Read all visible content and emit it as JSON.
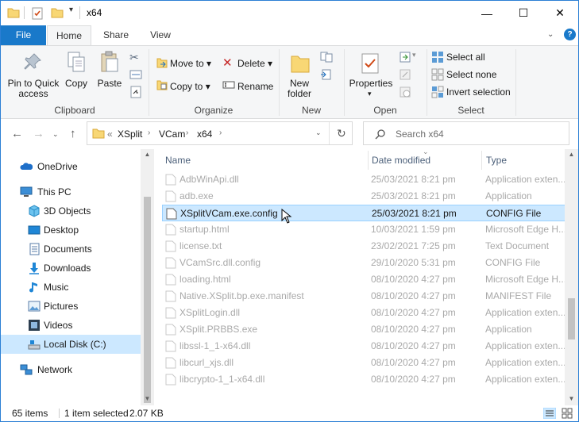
{
  "window": {
    "title": "x64",
    "controls": {
      "minimize": "—",
      "maximize": "☐",
      "close": "✕"
    }
  },
  "ribbon_tabs": [
    "File",
    "Home",
    "Share",
    "View"
  ],
  "ribbon": {
    "clipboard": {
      "label": "Clipboard",
      "pin_to_quick_access": "Pin to Quick\naccess",
      "copy": "Copy",
      "paste": "Paste"
    },
    "organize": {
      "label": "Organize",
      "move_to": "Move to",
      "copy_to": "Copy to",
      "delete": "Delete",
      "rename": "Rename"
    },
    "new": {
      "label": "New",
      "new_folder": "New\nfolder"
    },
    "open": {
      "label": "Open",
      "properties": "Properties"
    },
    "select": {
      "label": "Select",
      "select_all": "Select all",
      "select_none": "Select none",
      "invert_selection": "Invert selection"
    }
  },
  "address": {
    "crumbs": [
      "XSplit",
      "VCam",
      "x64"
    ],
    "overflow": "«"
  },
  "search": {
    "placeholder": "Search x64"
  },
  "nav_pane": {
    "items": [
      {
        "label": "OneDrive",
        "icon": "onedrive-icon"
      },
      {
        "label": "This PC",
        "icon": "computer-icon"
      },
      {
        "label": "3D Objects",
        "icon": "3d-objects-icon"
      },
      {
        "label": "Desktop",
        "icon": "desktop-icon"
      },
      {
        "label": "Documents",
        "icon": "documents-icon"
      },
      {
        "label": "Downloads",
        "icon": "downloads-icon"
      },
      {
        "label": "Music",
        "icon": "music-icon"
      },
      {
        "label": "Pictures",
        "icon": "pictures-icon"
      },
      {
        "label": "Videos",
        "icon": "videos-icon"
      },
      {
        "label": "Local Disk (C:)",
        "icon": "disk-icon"
      },
      {
        "label": "Network",
        "icon": "network-icon"
      }
    ]
  },
  "columns": [
    "Name",
    "Date modified",
    "Type"
  ],
  "files": [
    {
      "name": "AdbWinApi.dll",
      "date": "25/03/2021 8:21 pm",
      "type": "Application exten..."
    },
    {
      "name": "adb.exe",
      "date": "25/03/2021 8:21 pm",
      "type": "Application"
    },
    {
      "name": "XSplitVCam.exe.config",
      "date": "25/03/2021 8:21 pm",
      "type": "CONFIG File"
    },
    {
      "name": "startup.html",
      "date": "10/03/2021 1:59 pm",
      "type": "Microsoft Edge H..."
    },
    {
      "name": "license.txt",
      "date": "23/02/2021 7:25 pm",
      "type": "Text Document"
    },
    {
      "name": "VCamSrc.dll.config",
      "date": "29/10/2020 5:31 pm",
      "type": "CONFIG File"
    },
    {
      "name": "loading.html",
      "date": "08/10/2020 4:27 pm",
      "type": "Microsoft Edge H..."
    },
    {
      "name": "Native.XSplit.bp.exe.manifest",
      "date": "08/10/2020 4:27 pm",
      "type": "MANIFEST File"
    },
    {
      "name": "XSplitLogin.dll",
      "date": "08/10/2020 4:27 pm",
      "type": "Application exten..."
    },
    {
      "name": "XSplit.PRBBS.exe",
      "date": "08/10/2020 4:27 pm",
      "type": "Application"
    },
    {
      "name": "libssl-1_1-x64.dll",
      "date": "08/10/2020 4:27 pm",
      "type": "Application exten..."
    },
    {
      "name": "libcurl_xjs.dll",
      "date": "08/10/2020 4:27 pm",
      "type": "Application exten..."
    },
    {
      "name": "libcrypto-1_1-x64.dll",
      "date": "08/10/2020 4:27 pm",
      "type": "Application exten..."
    }
  ],
  "selected_file": "XSplitVCam.exe.config",
  "status": {
    "items_count": "65 items",
    "selected": "1 item selected",
    "size": "2.07 KB"
  },
  "colors": {
    "accent": "#1979ca",
    "selection": "#cce8ff",
    "selection_border": "#99d1ff",
    "header_text": "#4c607a",
    "dim_text": "#a9a9a9"
  }
}
